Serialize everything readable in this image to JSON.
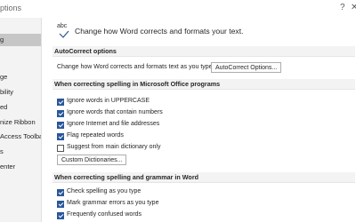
{
  "window": {
    "title": "ptions",
    "help_icon": "question-mark-icon",
    "close_icon": "close-icon"
  },
  "sidebar": {
    "items": [
      {
        "label": ""
      },
      {
        "label": "g"
      },
      {
        "label": ""
      },
      {
        "label": "ge"
      },
      {
        "label": "bility"
      },
      {
        "label": "ed"
      },
      {
        "label": "nize Ribbon"
      },
      {
        "label": "Access Toolbar"
      },
      {
        "label": "s"
      },
      {
        "label": "enter"
      }
    ],
    "selected_index": 1
  },
  "header": {
    "icon_text": "abc",
    "text": "Change how Word corrects and formats your text."
  },
  "autocorrect": {
    "heading": "AutoCorrect options",
    "description": "Change how Word corrects and formats text as you type:",
    "button_label": "AutoCorrect Options..."
  },
  "office_section": {
    "heading": "When correcting spelling in Microsoft Office programs",
    "options": [
      {
        "label": "Ignore words in UPPERCASE",
        "checked": true
      },
      {
        "label": "Ignore words that contain numbers",
        "checked": true
      },
      {
        "label": "Ignore Internet and file addresses",
        "checked": true
      },
      {
        "label": "Flag repeated words",
        "checked": true
      },
      {
        "label": "Suggest from main dictionary only",
        "checked": false
      }
    ],
    "button_label": "Custom Dictionaries..."
  },
  "word_section": {
    "heading": "When correcting spelling and grammar in Word",
    "options": [
      {
        "label": "Check spelling as you type",
        "checked": true
      },
      {
        "label": "Mark grammar errors as you type",
        "checked": true
      },
      {
        "label": "Frequently confused words",
        "checked": true
      }
    ]
  },
  "colors": {
    "accent": "#2b579a",
    "sidebar_bg": "#f3f3f3",
    "selected_bg": "#c6c6c6"
  }
}
